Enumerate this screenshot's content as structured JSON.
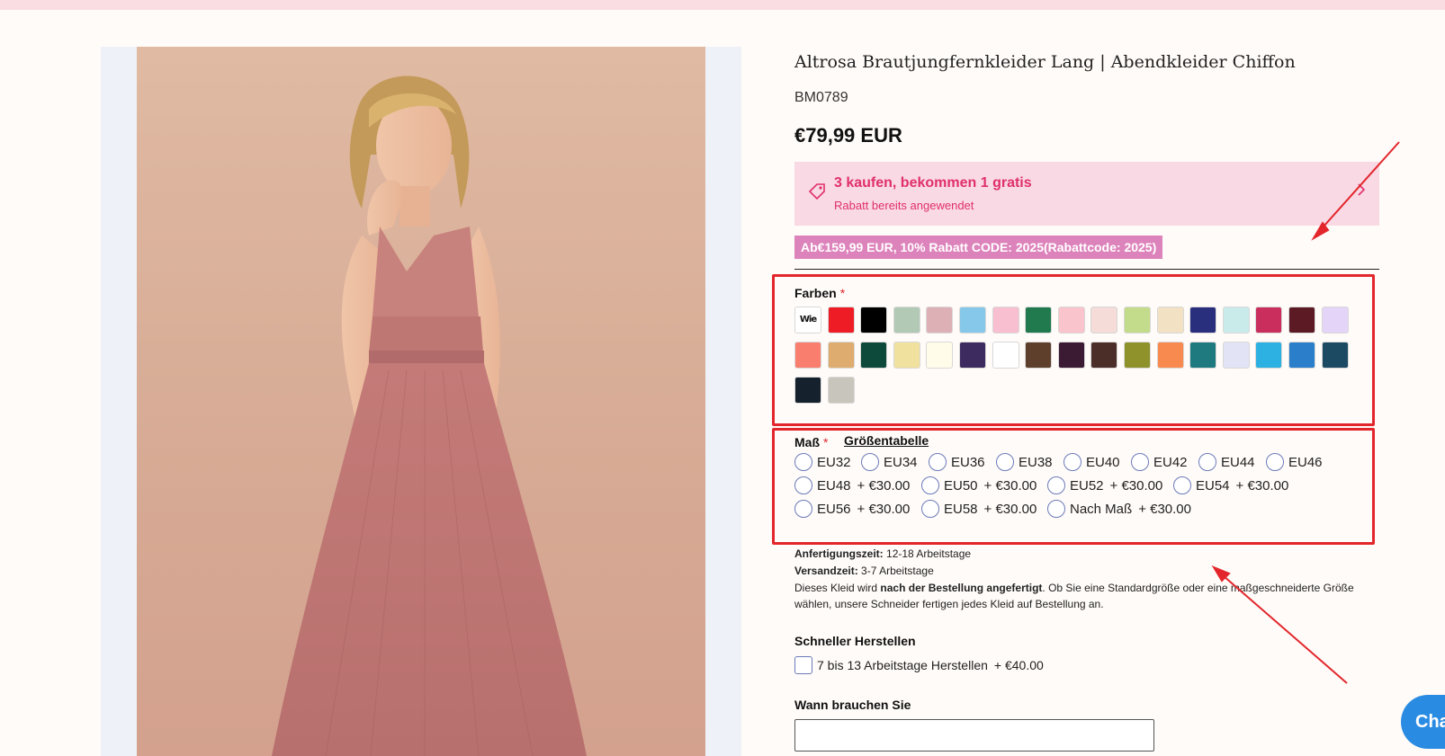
{
  "product": {
    "title": "Altrosa Brautjungfernkleider Lang | Abendkleider Chiffon",
    "sku": "BM0789",
    "price": "€79,99 EUR"
  },
  "promo": {
    "title": "3 kaufen, bekommen 1 gratis",
    "subtitle": "Rabatt bereits angewendet",
    "icon": "tag-icon",
    "chevron_icon": "chevron-right-icon"
  },
  "discount_code": "Ab€159,99 EUR, 10% Rabatt CODE: 2025(Rabattcode: 2025)",
  "colors": {
    "label": "Farben",
    "required_mark": "*",
    "picture_swatch_label": "Wie Bild",
    "swatches": [
      "Wie Bild",
      "#ee1c25",
      "#000000",
      "#b2c9b5",
      "#ddb0b6",
      "#86c8ea",
      "#f8bfd1",
      "#217a4e",
      "#fac4cc",
      "#f5dcd8",
      "#c2dc8b",
      "#f3e1c3",
      "#2a2f7d",
      "#c9ecea",
      "#c92e5c",
      "#5c1a24",
      "#e4d5f8",
      "#f97e6e",
      "#ddac6e",
      "#0e4a3c",
      "#f0e29e",
      "#fffde9",
      "#3d2b5f",
      "#ffffff",
      "#5d3f2b",
      "#3b1a33",
      "#4b2e28",
      "#8f922b",
      "#f98a4f",
      "#1f7a80",
      "#e3e3f6",
      "#2db0e2",
      "#2b7fca",
      "#1d4a63",
      "#16212e",
      "#c8c6bc"
    ]
  },
  "size": {
    "label": "Maß",
    "required_mark": "*",
    "chart_link": "Größentabelle",
    "options": [
      {
        "label": "EU32",
        "extra": ""
      },
      {
        "label": "EU34",
        "extra": ""
      },
      {
        "label": "EU36",
        "extra": ""
      },
      {
        "label": "EU38",
        "extra": ""
      },
      {
        "label": "EU40",
        "extra": ""
      },
      {
        "label": "EU42",
        "extra": ""
      },
      {
        "label": "EU44",
        "extra": ""
      },
      {
        "label": "EU46",
        "extra": ""
      },
      {
        "label": "EU48",
        "extra": "+ €30.00"
      },
      {
        "label": "EU50",
        "extra": "+ €30.00"
      },
      {
        "label": "EU52",
        "extra": "+ €30.00"
      },
      {
        "label": "EU54",
        "extra": "+ €30.00"
      },
      {
        "label": "EU56",
        "extra": "+ €30.00"
      },
      {
        "label": "EU58",
        "extra": "+ €30.00"
      },
      {
        "label": "Nach Maß",
        "extra": "+ €30.00"
      }
    ]
  },
  "production": {
    "lead_label": "Anfertigungszeit:",
    "lead_value": "12-18 Arbeitstage",
    "ship_label": "Versandzeit:",
    "ship_value": "3-7 Arbeitstage",
    "note_prefix": "Dieses Kleid wird",
    "note_bold": "nach der Bestellung angefertigt",
    "note_suffix": ". Ob Sie eine Standardgröße oder eine maßgeschneiderte Größe wählen, unsere Schneider fertigen jedes Kleid auf Bestellung an."
  },
  "rush": {
    "label": "Schneller Herstellen",
    "option": "7 bis 13 Arbeitstage Herstellen",
    "extra": "+ €40.00"
  },
  "needed_by": {
    "label": "Wann brauchen Sie",
    "value": ""
  },
  "chat": {
    "label": "Cha"
  },
  "accent_colors": {
    "annotation_red": "#e2262c",
    "promo_bg": "#f9d9e4",
    "promo_text": "#e0306b",
    "code_bg": "#dd83bb",
    "chat_blue": "#2a8be2"
  }
}
